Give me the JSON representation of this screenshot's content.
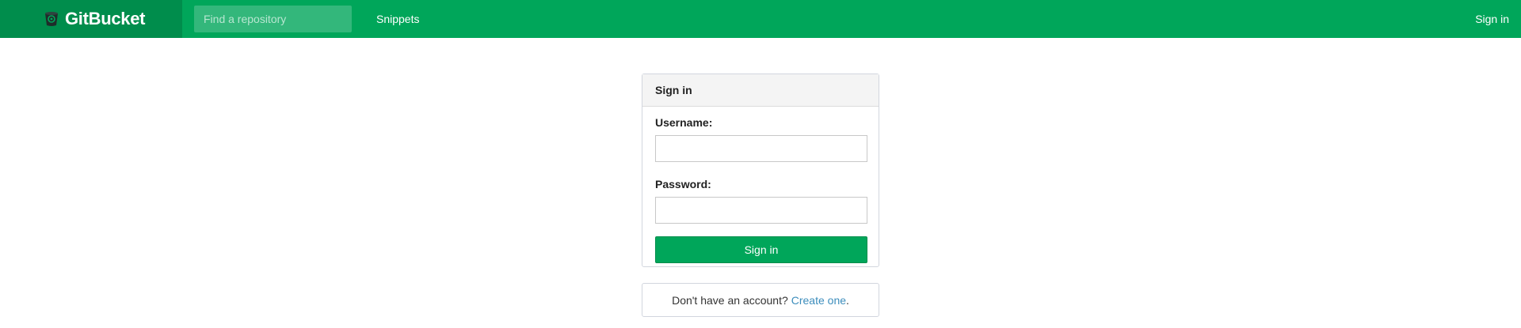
{
  "navbar": {
    "brand": "GitBucket",
    "brand_icon": "bucket-logo-icon",
    "search_placeholder": "Find a repository",
    "snippets_label": "Snippets",
    "signin_label": "Sign in"
  },
  "login_panel": {
    "heading": "Sign in",
    "username_label": "Username:",
    "username_value": "",
    "password_label": "Password:",
    "password_value": "",
    "submit_label": "Sign in"
  },
  "signup_box": {
    "prompt": "Don't have an account?",
    "link_label": "Create one",
    "trailing": "."
  },
  "colors": {
    "navbar_bg": "#00a65a",
    "brand_bg": "#008d4c",
    "button_bg": "#00a65a",
    "link": "#3c8dbc"
  }
}
